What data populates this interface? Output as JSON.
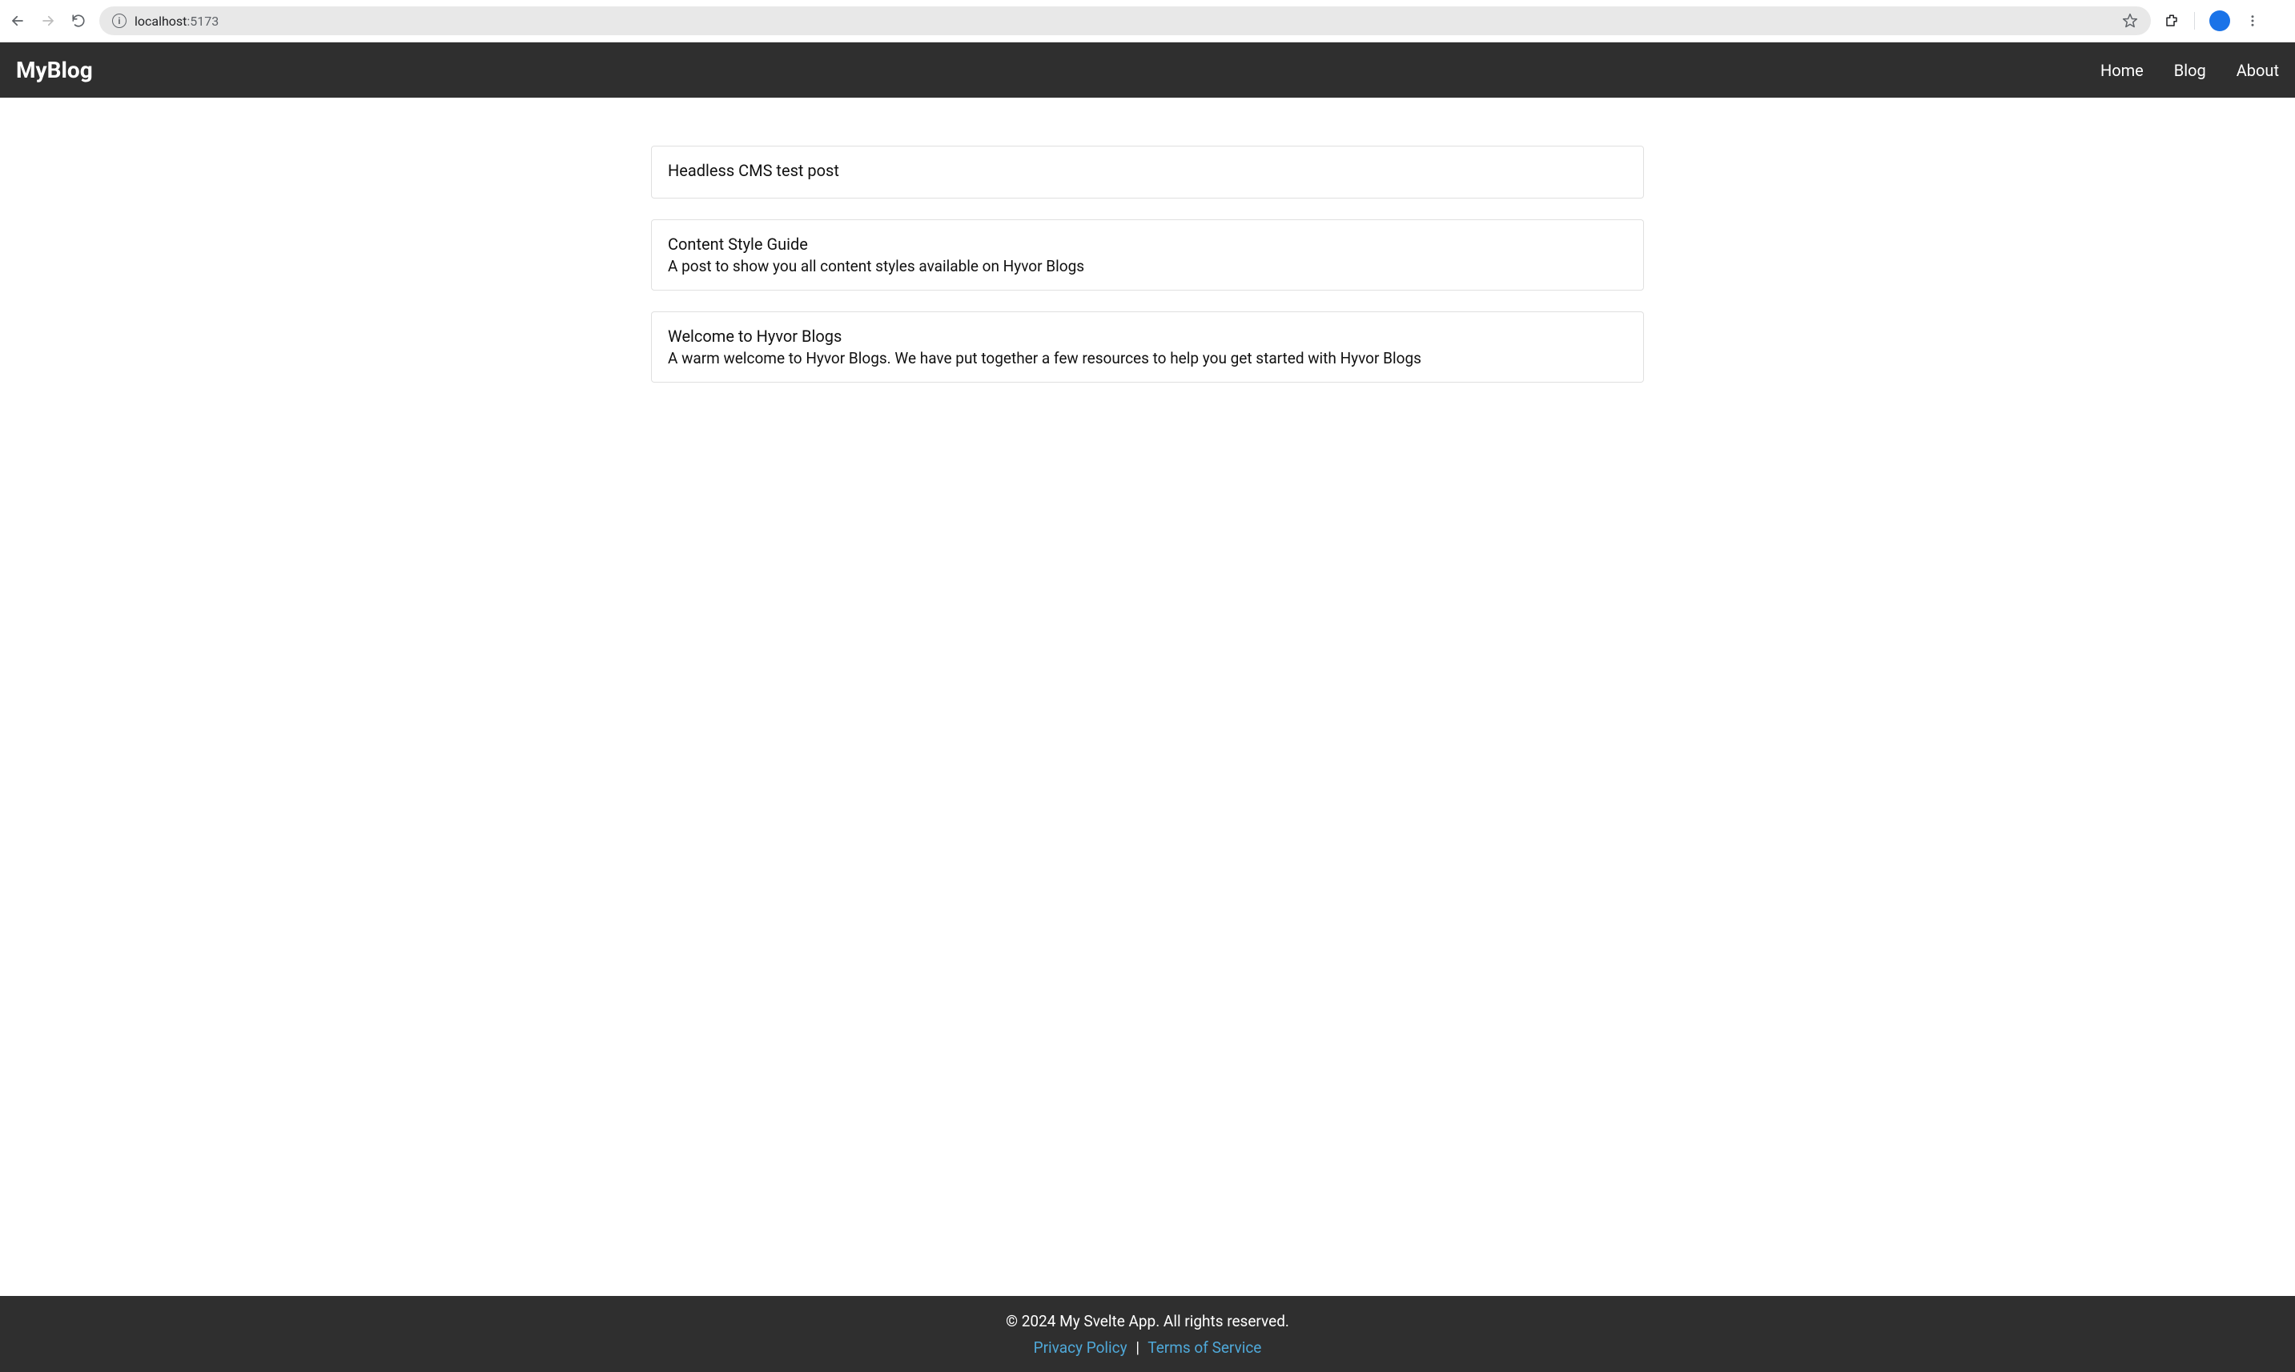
{
  "browser": {
    "url_host": "localhost",
    "url_port": ":5173"
  },
  "header": {
    "logo": "MyBlog",
    "nav": [
      {
        "label": "Home"
      },
      {
        "label": "Blog"
      },
      {
        "label": "About"
      }
    ]
  },
  "posts": [
    {
      "title": "Headless CMS test post",
      "description": ""
    },
    {
      "title": "Content Style Guide",
      "description": "A post to show you all content styles available on Hyvor Blogs"
    },
    {
      "title": "Welcome to Hyvor Blogs",
      "description": "A warm welcome to Hyvor Blogs. We have put together a few resources to help you get started with Hyvor Blogs"
    }
  ],
  "footer": {
    "copyright": "© 2024 My Svelte App. All rights reserved.",
    "privacy_label": "Privacy Policy",
    "separator": "|",
    "terms_label": "Terms of Service"
  }
}
